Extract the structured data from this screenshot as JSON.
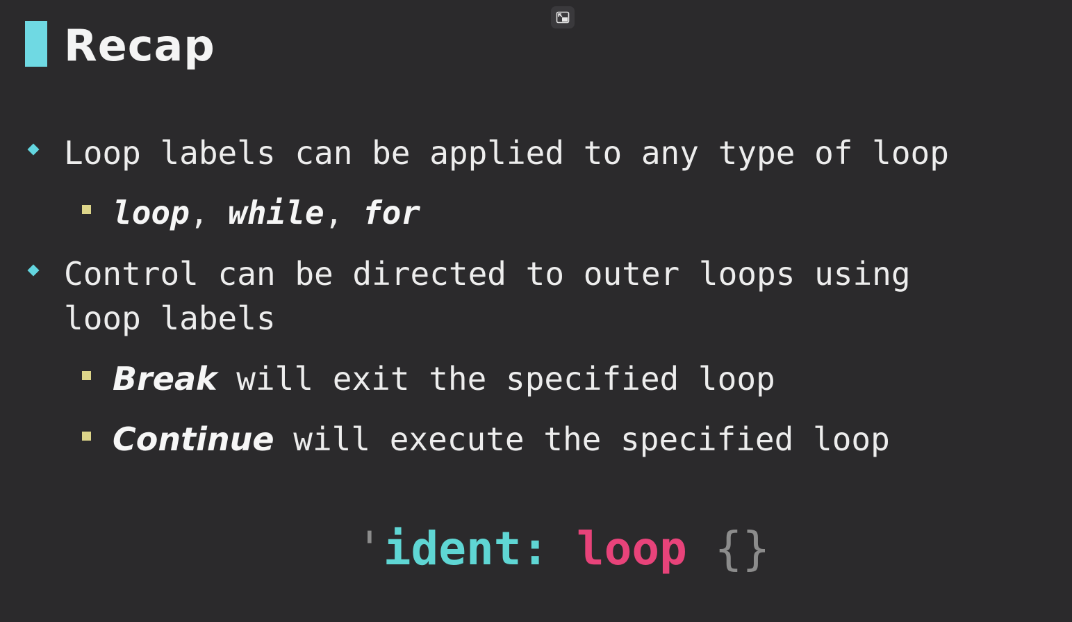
{
  "slide": {
    "title": "Recap",
    "bullets": [
      {
        "text": "Loop labels can be applied to any type of loop",
        "sub": {
          "kw1": "loop",
          "sep1": ", ",
          "kw2": "while",
          "sep2": ", ",
          "kw3": "for"
        }
      },
      {
        "line1": "Control can be directed to outer loops using",
        "line2": "loop labels",
        "subs": [
          {
            "keyword": "Break",
            "rest": " will exit the specified loop"
          },
          {
            "keyword": "Continue",
            "rest": " will execute the specified loop"
          }
        ]
      }
    ],
    "code": {
      "quote": "'",
      "ident": "ident:",
      "space": " ",
      "loop": "loop",
      "space2": " ",
      "braces": "{}"
    }
  },
  "colors": {
    "background": "#2b2a2c",
    "accent_cyan": "#63d6e0",
    "accent_yellow": "#ddd58a",
    "code_pink": "#e8437a",
    "code_teal": "#5fd6d4"
  },
  "icons": {
    "pip_button": "exit-picture-in-picture-icon"
  }
}
